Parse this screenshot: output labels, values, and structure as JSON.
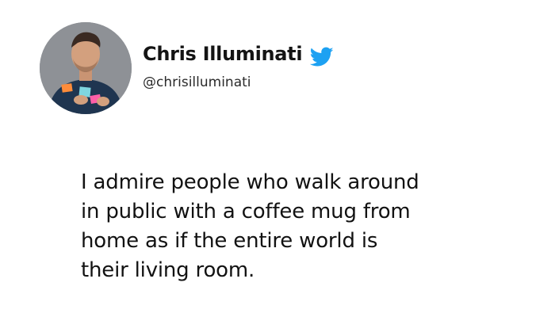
{
  "tweet": {
    "author": {
      "display_name": "Chris Illuminati",
      "handle": "@chrisilluminati",
      "avatar_icon": "avatar-photo",
      "platform_icon": "twitter-bird-icon"
    },
    "text": "I admire people who walk around\nin public with a coffee mug from\nhome as if the entire world is\ntheir living room."
  },
  "colors": {
    "background": "#ffffff",
    "text": "#121212",
    "twitter_blue": "#1DA1F2"
  }
}
